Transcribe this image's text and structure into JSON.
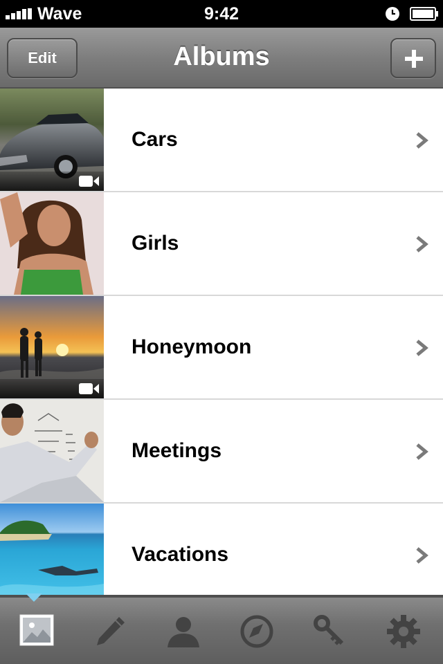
{
  "status_bar": {
    "carrier": "Wave",
    "time": "9:42",
    "icons": [
      "signal-bars-icon",
      "alarm-clock-icon",
      "battery-icon"
    ]
  },
  "nav_bar": {
    "title": "Albums",
    "edit_label": "Edit",
    "add_icon": "plus-icon"
  },
  "albums": [
    {
      "name": "Cars",
      "has_video": true,
      "thumb": "car-photo"
    },
    {
      "name": "Girls",
      "has_video": false,
      "thumb": "woman-portrait-photo"
    },
    {
      "name": "Honeymoon",
      "has_video": true,
      "thumb": "beach-sunset-couple-photo"
    },
    {
      "name": "Meetings",
      "has_video": false,
      "thumb": "man-at-whiteboard-photo"
    },
    {
      "name": "Vacations",
      "has_video": false,
      "thumb": "underwater-island-photo"
    }
  ],
  "tabs": [
    {
      "icon": "photos-icon",
      "selected": true
    },
    {
      "icon": "pencil-icon",
      "selected": false
    },
    {
      "icon": "contact-icon",
      "selected": false
    },
    {
      "icon": "compass-icon",
      "selected": false
    },
    {
      "icon": "key-icon",
      "selected": false
    },
    {
      "icon": "gear-icon",
      "selected": false
    }
  ],
  "colors": {
    "nav_gradient_top": "#9a9a9a",
    "nav_gradient_bottom": "#6a6a6a",
    "tab_selected_indicator": "#7fd0f0",
    "separator": "#d8d8d8"
  }
}
